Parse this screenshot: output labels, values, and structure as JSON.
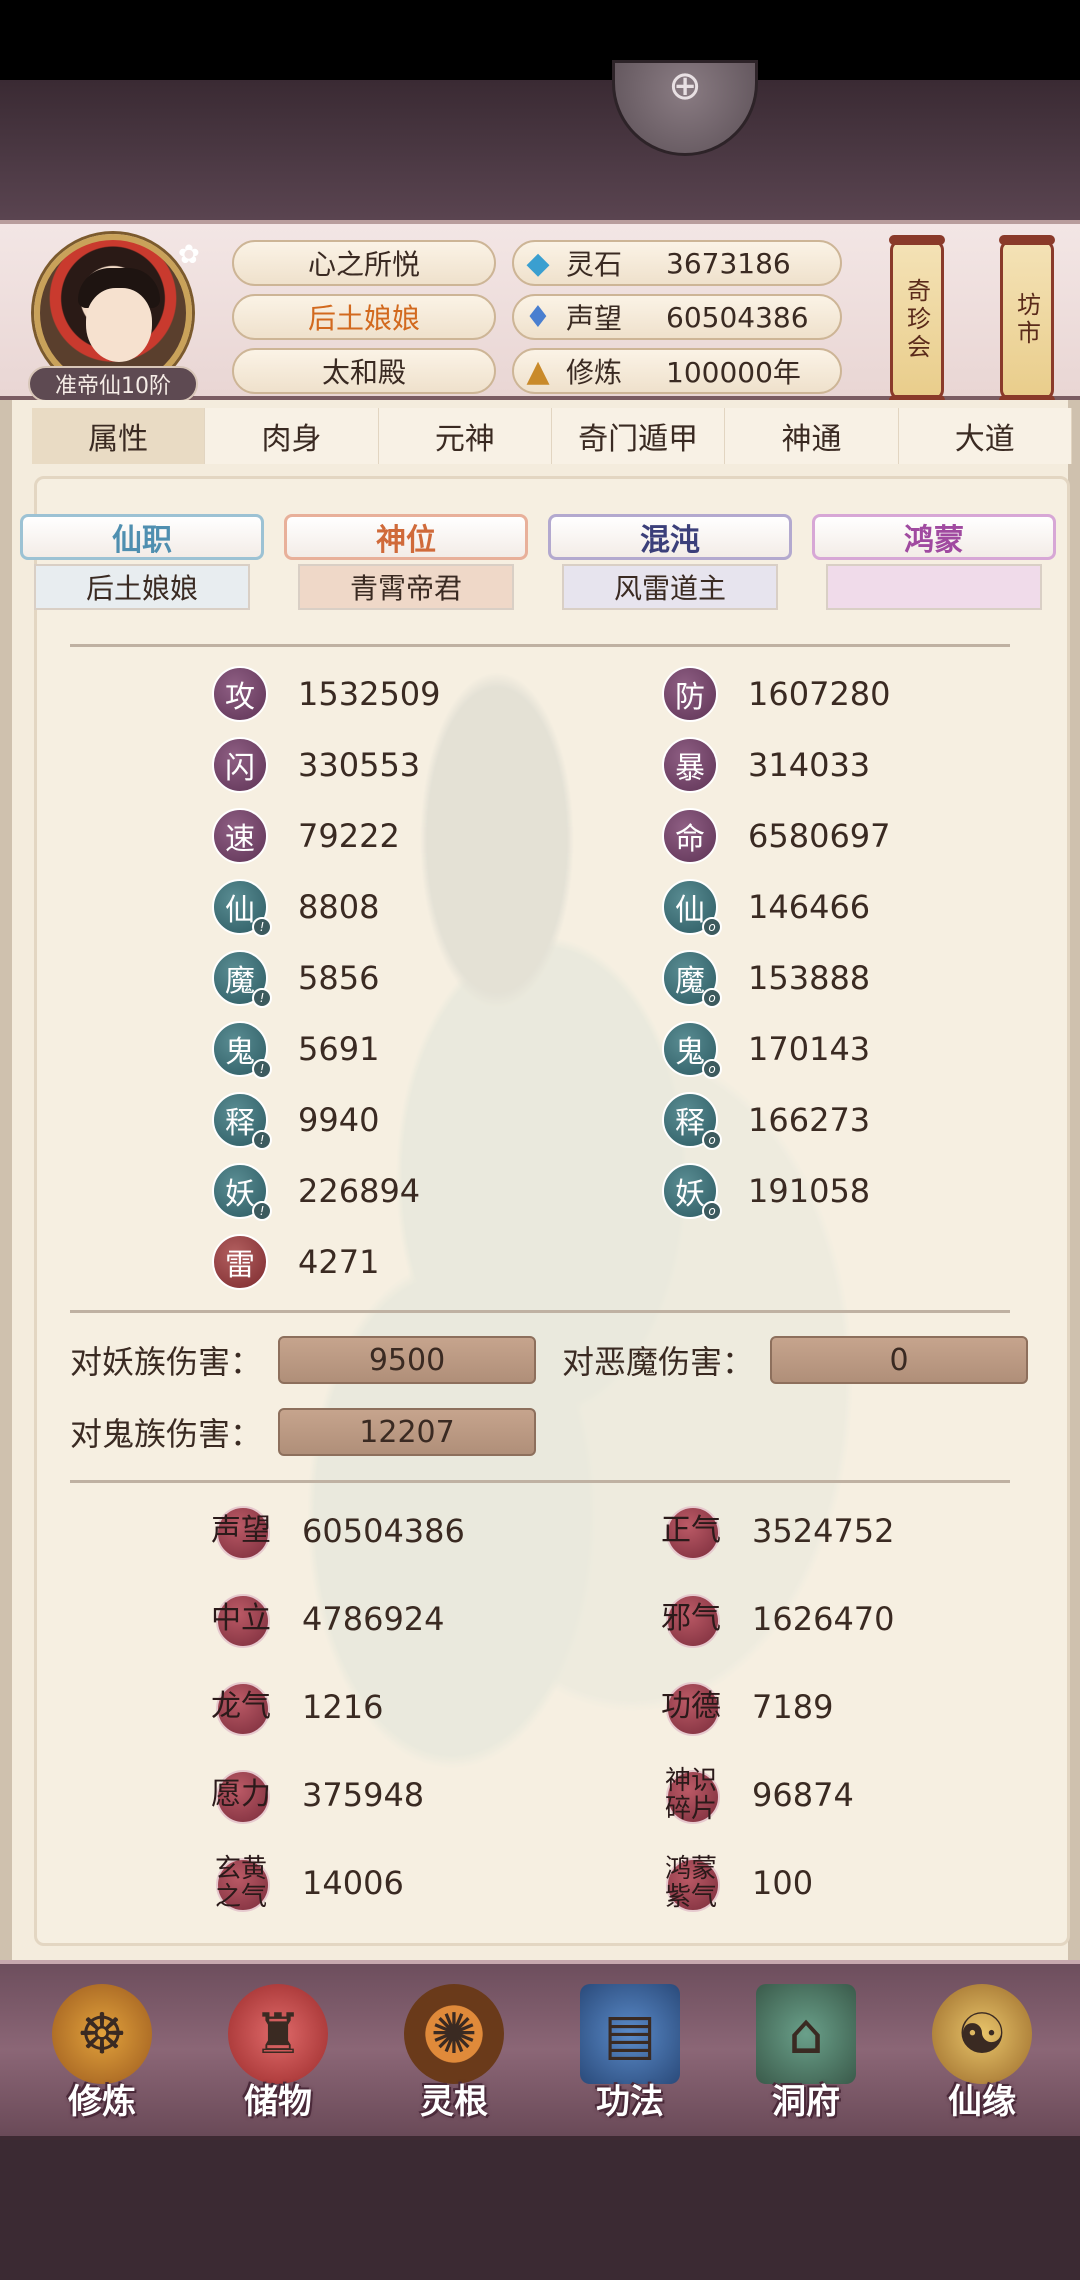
{
  "header": {
    "rank_badge": "准帝仙10阶",
    "titles": [
      "心之所悦",
      "后土娘娘",
      "太和殿"
    ],
    "resources": [
      {
        "icon": "spirit-stone-icon",
        "label": "灵石",
        "value": "3673186"
      },
      {
        "icon": "prestige-icon",
        "label": "声望",
        "value": "60504386"
      },
      {
        "icon": "cultivation-icon",
        "label": "修炼",
        "value": "100000年"
      }
    ],
    "scroll_buttons": [
      "奇珍会",
      "坊市"
    ]
  },
  "tabs": [
    "属性",
    "肉身",
    "元神",
    "奇门遁甲",
    "神通",
    "大道"
  ],
  "active_tab": "属性",
  "rank_tabs": [
    {
      "label": "仙职",
      "value": "后土娘娘",
      "color": "#4f8fb0"
    },
    {
      "label": "神位",
      "value": "青霄帝君",
      "color": "#d06a3a"
    },
    {
      "label": "混沌",
      "value": "风雷道主",
      "color": "#3b3f7a"
    },
    {
      "label": "鸿蒙",
      "value": "",
      "color": "#a04aa0"
    }
  ],
  "stats_left": [
    {
      "glyph": "攻",
      "value": "1532509",
      "style": "purple",
      "badge": ""
    },
    {
      "glyph": "闪",
      "value": "330553",
      "style": "purple",
      "badge": ""
    },
    {
      "glyph": "速",
      "value": "79222",
      "style": "purple",
      "badge": ""
    },
    {
      "glyph": "仙",
      "value": "8808",
      "style": "teal",
      "badge": "!"
    },
    {
      "glyph": "魔",
      "value": "5856",
      "style": "teal",
      "badge": "!"
    },
    {
      "glyph": "鬼",
      "value": "5691",
      "style": "teal",
      "badge": "!"
    },
    {
      "glyph": "释",
      "value": "9940",
      "style": "teal",
      "badge": "!"
    },
    {
      "glyph": "妖",
      "value": "226894",
      "style": "teal",
      "badge": "!"
    },
    {
      "glyph": "雷",
      "value": "4271",
      "style": "red",
      "badge": ""
    }
  ],
  "stats_right": [
    {
      "glyph": "防",
      "value": "1607280",
      "style": "purple",
      "badge": ""
    },
    {
      "glyph": "暴",
      "value": "314033",
      "style": "purple",
      "badge": ""
    },
    {
      "glyph": "命",
      "value": "6580697",
      "style": "purple",
      "badge": ""
    },
    {
      "glyph": "仙",
      "value": "146466",
      "style": "teal",
      "badge": "o"
    },
    {
      "glyph": "魔",
      "value": "153888",
      "style": "teal",
      "badge": "o"
    },
    {
      "glyph": "鬼",
      "value": "170143",
      "style": "teal",
      "badge": "o"
    },
    {
      "glyph": "释",
      "value": "166273",
      "style": "teal",
      "badge": "o"
    },
    {
      "glyph": "妖",
      "value": "191058",
      "style": "teal",
      "badge": "o"
    }
  ],
  "damage": [
    {
      "label": "对妖族伤害：",
      "value": "9500"
    },
    {
      "label": "对恶魔伤害：",
      "value": "0"
    },
    {
      "label": "对鬼族伤害：",
      "value": "12207"
    }
  ],
  "resources_left": [
    {
      "glyph": "声望",
      "value": "60504386"
    },
    {
      "glyph": "中立",
      "value": "4786924"
    },
    {
      "glyph": "龙气",
      "value": "1216"
    },
    {
      "glyph": "愿力",
      "value": "375948"
    },
    {
      "glyph": "玄黄之气",
      "value": "14006"
    }
  ],
  "resources_right": [
    {
      "glyph": "正气",
      "value": "3524752"
    },
    {
      "glyph": "邪气",
      "value": "1626470"
    },
    {
      "glyph": "功德",
      "value": "7189"
    },
    {
      "glyph": "神识碎片",
      "value": "96874"
    },
    {
      "glyph": "鸿蒙紫气",
      "value": "100"
    }
  ],
  "nav": [
    {
      "label": "修炼",
      "icon": "meditation-icon"
    },
    {
      "label": "储物",
      "icon": "storage-bag-icon"
    },
    {
      "label": "灵根",
      "icon": "spirit-root-icon"
    },
    {
      "label": "功法",
      "icon": "manual-book-icon"
    },
    {
      "label": "洞府",
      "icon": "cave-mansion-icon"
    },
    {
      "label": "仙缘",
      "icon": "fortune-gourd-icon"
    }
  ]
}
